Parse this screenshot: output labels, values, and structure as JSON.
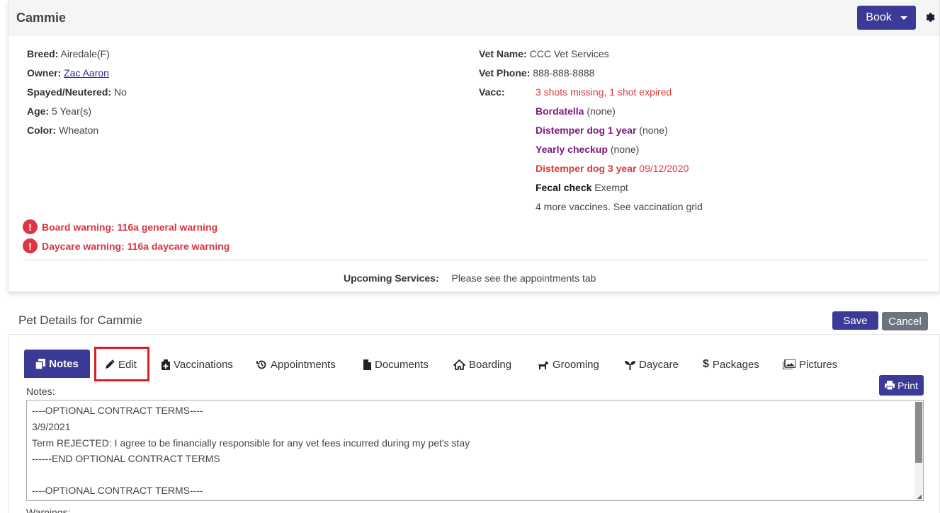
{
  "header": {
    "pet_name": "Cammie",
    "book_label": "Book"
  },
  "info_left": {
    "breed_label": "Breed:",
    "breed": "Airedale(F)",
    "owner_label": "Owner:",
    "owner": "Zac Aaron",
    "spayed_label": "Spayed/Neutered:",
    "spayed": "No",
    "age_label": "Age:",
    "age": "5 Year(s)",
    "color_label": "Color:",
    "color": "Wheaton"
  },
  "info_right": {
    "vet_name_label": "Vet Name:",
    "vet_name": "CCC Vet Services",
    "vet_phone_label": "Vet Phone:",
    "vet_phone": "888-888-8888",
    "vacc_label": "Vacc:",
    "vacc_summary": "3 shots missing, 1 shot expired",
    "vaccines": [
      {
        "name": "Bordatella",
        "status": "(none)"
      },
      {
        "name": "Distemper dog 1 year",
        "status": "(none)"
      },
      {
        "name": "Yearly checkup",
        "status": "(none)"
      },
      {
        "name": "Distemper dog 3 year",
        "status": "09/12/2020"
      },
      {
        "name": "Fecal check",
        "status": "Exempt"
      }
    ],
    "more_vaccines": "4 more vaccines. See vaccination grid"
  },
  "warnings": [
    "Board warning: 116a general warning",
    "Daycare warning: 116a daycare warning"
  ],
  "upcoming": {
    "label": "Upcoming Services:",
    "value": "Please see the appointments tab"
  },
  "details": {
    "title": "Pet Details for Cammie",
    "save_label": "Save",
    "cancel_label": "Cancel"
  },
  "tabs": [
    {
      "label": "Notes",
      "icon": "copy-icon"
    },
    {
      "label": "Edit",
      "icon": "pencil-icon"
    },
    {
      "label": "Vaccinations",
      "icon": "medkit-icon"
    },
    {
      "label": "Appointments",
      "icon": "history-icon"
    },
    {
      "label": "Documents",
      "icon": "file-icon"
    },
    {
      "label": "Boarding",
      "icon": "home-icon"
    },
    {
      "label": "Grooming",
      "icon": "dog-icon"
    },
    {
      "label": "Daycare",
      "icon": "seedling-icon"
    },
    {
      "label": "Packages",
      "icon": "dollar-icon"
    },
    {
      "label": "Pictures",
      "icon": "images-icon"
    }
  ],
  "notes": {
    "label": "Notes:",
    "print_label": "Print",
    "lines": [
      "----OPTIONAL CONTRACT TERMS----",
      "3/9/2021",
      "Term REJECTED: I agree to be financially responsible for any vet fees incurred during my pet's stay",
      "------END OPTIONAL CONTRACT TERMS",
      "",
      "----OPTIONAL CONTRACT TERMS----"
    ]
  },
  "warnings_label": "Warnings:",
  "colors": {
    "primary": "#3b3a96",
    "danger": "#dc3545",
    "purple": "#7b1c80",
    "secondary": "#6c757d",
    "highlight": "#e01b24"
  }
}
